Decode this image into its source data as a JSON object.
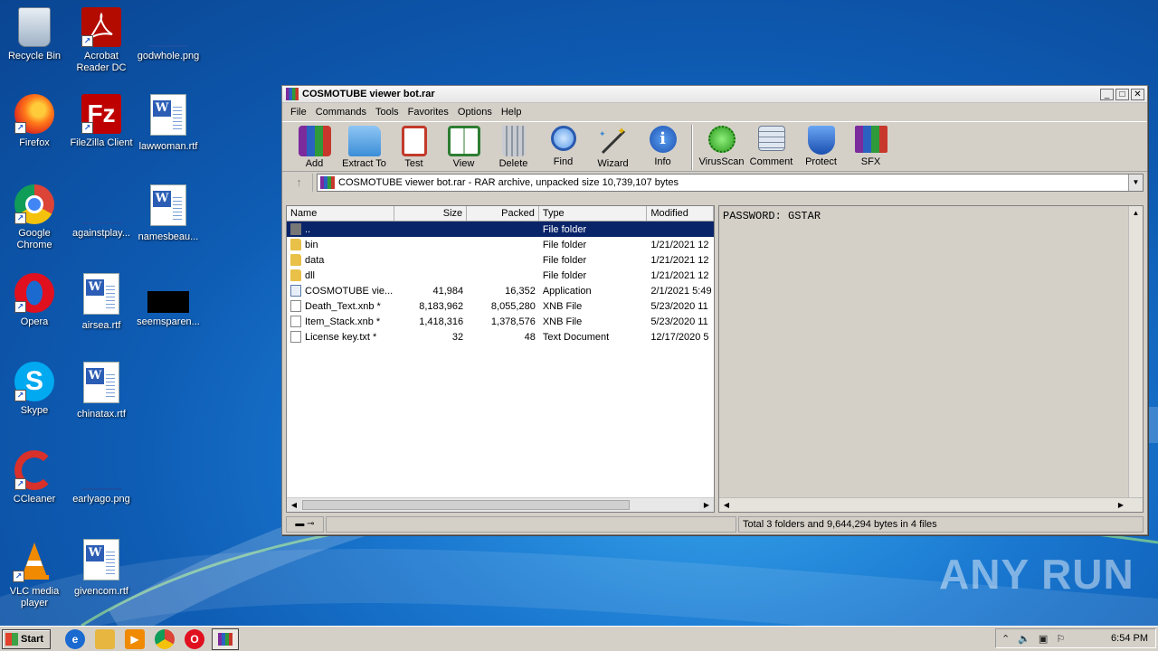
{
  "desktop": {
    "icons": [
      {
        "label": "Recycle Bin"
      },
      {
        "label": "Acrobat Reader DC"
      },
      {
        "label": "godwhole.png"
      },
      {
        "label": "Firefox"
      },
      {
        "label": "FileZilla Client"
      },
      {
        "label": "lawwoman.rtf"
      },
      {
        "label": "Google Chrome"
      },
      {
        "label": "againstplay..."
      },
      {
        "label": "namesbeau..."
      },
      {
        "label": "Opera"
      },
      {
        "label": "airsea.rtf"
      },
      {
        "label": "seemsparen..."
      },
      {
        "label": "Skype"
      },
      {
        "label": "chinatax.rtf"
      },
      {
        "label": "CCleaner"
      },
      {
        "label": "earlyago.png"
      },
      {
        "label": "VLC media player"
      },
      {
        "label": "givencom.rtf"
      }
    ]
  },
  "window": {
    "title": "COSMOTUBE viewer bot.rar",
    "menu": [
      "File",
      "Commands",
      "Tools",
      "Favorites",
      "Options",
      "Help"
    ],
    "toolbar": [
      {
        "label": "Add",
        "icon": "add-archive-icon"
      },
      {
        "label": "Extract To",
        "icon": "extract-folder-icon"
      },
      {
        "label": "Test",
        "icon": "test-clipboard-icon"
      },
      {
        "label": "View",
        "icon": "view-book-icon"
      },
      {
        "label": "Delete",
        "icon": "trash-icon"
      },
      {
        "label": "Find",
        "icon": "magnifier-icon"
      },
      {
        "label": "Wizard",
        "icon": "wand-icon"
      },
      {
        "label": "Info",
        "icon": "info-icon"
      },
      {
        "label": "VirusScan",
        "icon": "virus-icon"
      },
      {
        "label": "Comment",
        "icon": "comment-icon"
      },
      {
        "label": "Protect",
        "icon": "shield-icon"
      },
      {
        "label": "SFX",
        "icon": "sfx-box-icon"
      }
    ],
    "address": "COSMOTUBE viewer bot.rar - RAR archive, unpacked size 10,739,107 bytes",
    "columns": {
      "name": "Name",
      "size": "Size",
      "packed": "Packed",
      "type": "Type",
      "modified": "Modified"
    },
    "files": [
      {
        "name": "..",
        "size": "",
        "packed": "",
        "type": "File folder",
        "modified": "",
        "kind": "up"
      },
      {
        "name": "bin",
        "size": "",
        "packed": "",
        "type": "File folder",
        "modified": "1/21/2021 12",
        "kind": "folder"
      },
      {
        "name": "data",
        "size": "",
        "packed": "",
        "type": "File folder",
        "modified": "1/21/2021 12",
        "kind": "folder"
      },
      {
        "name": "dll",
        "size": "",
        "packed": "",
        "type": "File folder",
        "modified": "1/21/2021 12",
        "kind": "folder"
      },
      {
        "name": "COSMOTUBE vie...",
        "size": "41,984",
        "packed": "16,352",
        "type": "Application",
        "modified": "2/1/2021 5:49",
        "kind": "app"
      },
      {
        "name": "Death_Text.xnb *",
        "size": "8,183,962",
        "packed": "8,055,280",
        "type": "XNB File",
        "modified": "5/23/2020 11",
        "kind": "doc"
      },
      {
        "name": "Item_Stack.xnb *",
        "size": "1,418,316",
        "packed": "1,378,576",
        "type": "XNB File",
        "modified": "5/23/2020 11",
        "kind": "doc"
      },
      {
        "name": "License key.txt *",
        "size": "32",
        "packed": "48",
        "type": "Text Document",
        "modified": "12/17/2020 5",
        "kind": "doc"
      }
    ],
    "comment_text": "PASSWORD: GSTAR",
    "status": "Total 3 folders and 9,644,294 bytes in 4 files"
  },
  "taskbar": {
    "start_label": "Start",
    "clock": "6:54 PM"
  },
  "watermark": "ANY RUN"
}
